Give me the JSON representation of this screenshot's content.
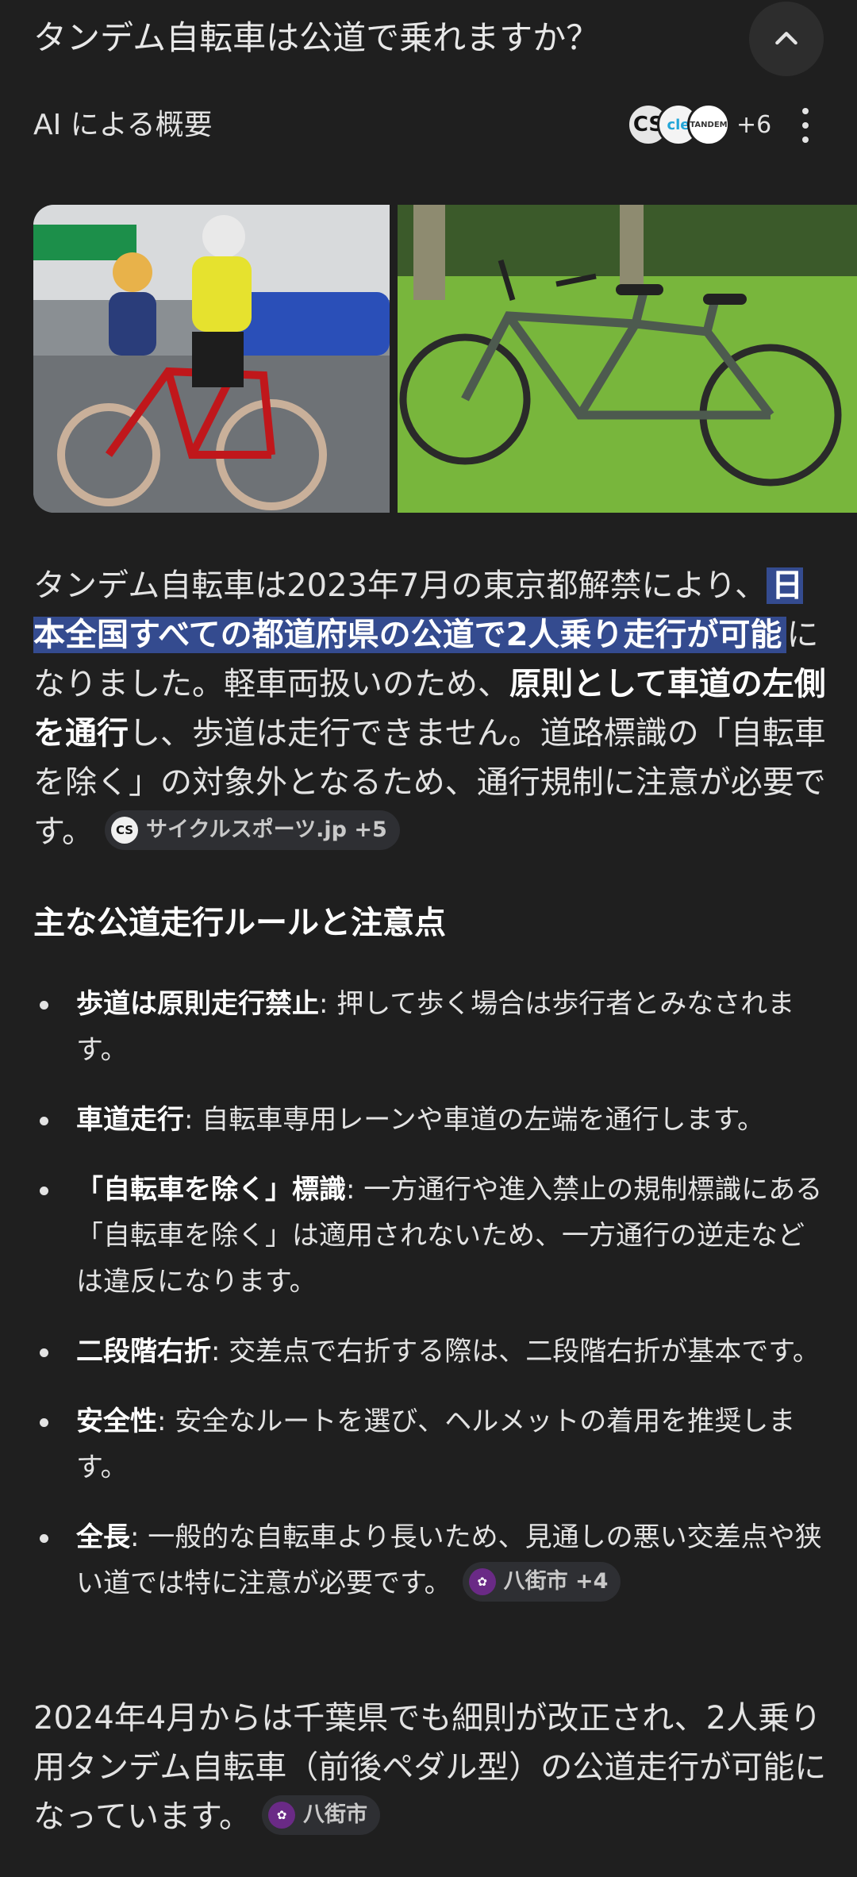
{
  "question": "タンデム自転車は公道で乗れますか？",
  "ai_overview": {
    "label": "AI による概要",
    "source_logos": [
      "CS",
      "cle",
      "TANDEM"
    ],
    "more_sources": "+6"
  },
  "images": [
    {
      "alt": "二人乗りの赤いタンデム自転車に乗る人々"
    },
    {
      "alt": "芝生の上のグレーのタンデム自転車"
    }
  ],
  "summary": {
    "p1": "タンデム自転車は2023年7月の東京都解禁により、",
    "highlight": "日本全国すべての都道府県の公道で2人乗り走行が可能",
    "p2": "になりました。軽車両扱いのため、",
    "bold": "原則として車道の左側を通行",
    "p3": "し、歩道は走行できません。道路標識の「自転車を除く」の対象外となるため、通行規制に注意が必要です。",
    "chip": "サイクルスポーツ.jp +5",
    "chip_icon": "CS"
  },
  "section_title": "主な公道走行ルールと注意点",
  "rules": [
    {
      "term": "歩道は原則走行禁止",
      "text": ": 押して歩く場合は歩行者とみなされます。"
    },
    {
      "term": "車道走行",
      "text": ": 自転車専用レーンや車道の左端を通行します。"
    },
    {
      "term": "「自転車を除く」標識",
      "text": ": 一方通行や進入禁止の規制標識にある「自転車を除く」は適用されないため、一方通行の逆走などは違反になります。"
    },
    {
      "term": "二段階右折",
      "text": ": 交差点で右折する際は、二段階右折が基本です。"
    },
    {
      "term": "安全性",
      "text": ": 安全なルートを選び、ヘルメットの着用を推奨します。"
    },
    {
      "term": "全長",
      "text": ": 一般的な自転車より長いため、見通しの悪い交差点や狭い道では特に注意が必要です。",
      "chip": "八街市 +4"
    }
  ],
  "footer": {
    "text": "2024年4月からは千葉県でも細則が改正され、2人乗り用タンデム自転車（前後ペダル型）の公道走行が可能になっています。",
    "chip": "八街市"
  },
  "colors": {
    "background": "#1f1f1f",
    "highlight": "#344b8f",
    "chip_bg": "#2e2f33",
    "city_icon": "#6a2a86"
  }
}
